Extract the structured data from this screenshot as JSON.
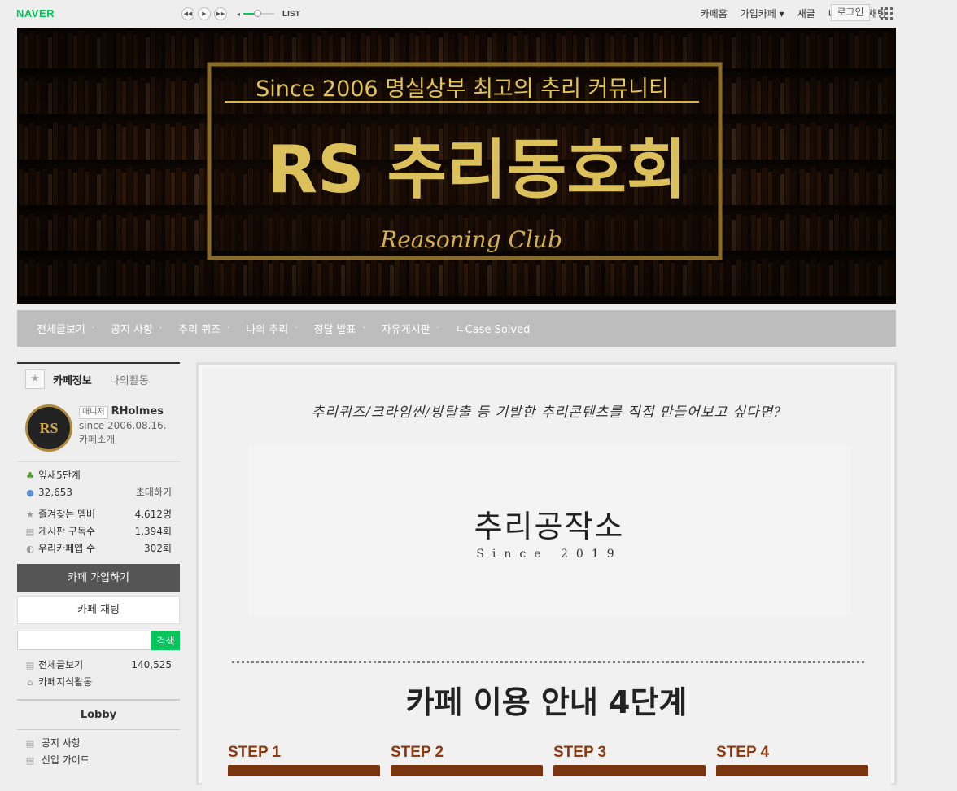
{
  "topbar": {
    "logo": "NAVER",
    "player": {
      "prev": "◀◀",
      "play": "▶",
      "next": "▶▶",
      "list": "LIST",
      "volume": 0.45
    },
    "nav": [
      "카페홈",
      "가입카페 ▾",
      "새글",
      "내소식",
      "채팅"
    ],
    "login": "로그인"
  },
  "banner": {
    "tagline": "Since 2006  명실상부 최고의 추리 커뮤니티",
    "title": "RS 추리동호회",
    "script": "Reasoning Club"
  },
  "menu": [
    "전체글보기",
    "공지 사항",
    "추리 퀴즈",
    "나의 추리",
    "정답 발표",
    "자유게시판",
    "ㄴCase Solved"
  ],
  "sidebar": {
    "tabs": {
      "active": "카페정보",
      "other": "나의활동"
    },
    "profile": {
      "badge": "매니저",
      "name": "RHolmes",
      "since": "since 2006.08.16.",
      "intro": "카페소개",
      "logo_text": "RS"
    },
    "level": "잎새5단계",
    "members": "32,653",
    "invite": "초대하기",
    "stats": [
      {
        "label": "즐겨찾는 멤버",
        "value": "4,612명"
      },
      {
        "label": "게시판 구독수",
        "value": "1,394회"
      },
      {
        "label": "우리카페앱 수",
        "value": "302회"
      }
    ],
    "join_button": "카페 가입하기",
    "chat_button": "카페 채팅",
    "search_button": "검색",
    "all_posts": {
      "label": "전체글보기",
      "count": "140,525"
    },
    "knowledge": "카페지식활동",
    "lobby": "Lobby",
    "board_items": [
      "공지 사항",
      "신입 가이드"
    ]
  },
  "main": {
    "headline": "추리퀴즈/크라임씬/방탈출 등 기발한 추리콘텐츠를 직접 만들어보고 싶다면?",
    "workshop_title": "추리공작소",
    "workshop_since": "Since 2019",
    "guide_title": "카페 이용 안내 4단계",
    "steps": [
      "STEP 1",
      "STEP 2",
      "STEP 3",
      "STEP 4"
    ]
  },
  "colors": {
    "naver_green": "#03c75a",
    "menu_bg": "#bdbdbd",
    "step_brown": "#7a3610",
    "banner_gold": "#d9b54a"
  }
}
